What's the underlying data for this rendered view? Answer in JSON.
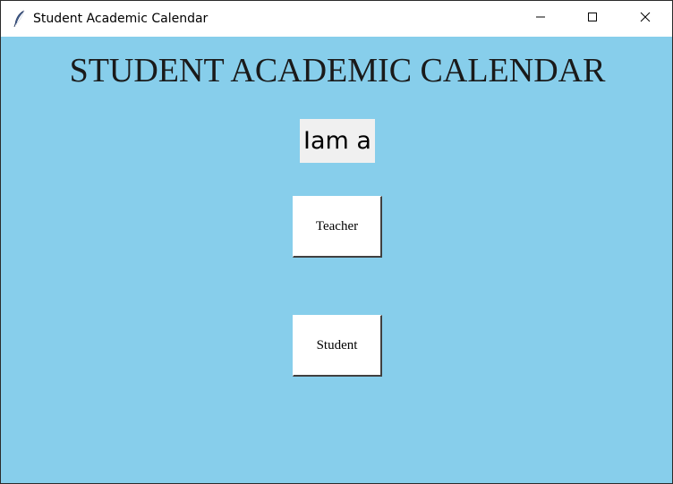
{
  "window": {
    "title": "Student Academic Calendar",
    "icon": "feather-icon",
    "controls": [
      "minimize-icon",
      "maximize-icon",
      "close-icon"
    ]
  },
  "main": {
    "heading": "STUDENT ACADEMIC CALENDAR",
    "prompt": "Iam a",
    "buttons": {
      "teacher": "Teacher",
      "student": "Student"
    }
  },
  "colors": {
    "background": "#87ceeb",
    "titlebar": "#ffffff",
    "prompt_bg": "#f0f0f0",
    "button_bg": "#ffffff"
  }
}
